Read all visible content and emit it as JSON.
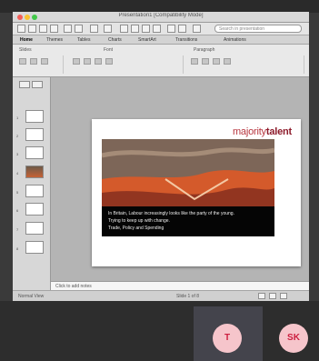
{
  "window": {
    "title": "Presentation1 [Compatibility Mode]"
  },
  "search": {
    "placeholder": "Search in presentation"
  },
  "ribbon": {
    "tabs": [
      "Home",
      "Themes",
      "Tables",
      "Charts",
      "SmartArt",
      "Transitions",
      "Animations"
    ],
    "groups": {
      "slides": "Slides",
      "font": "Font",
      "paragraph": "Paragraph"
    }
  },
  "status": {
    "left": "Normal View",
    "right": "Slide 1 of 8"
  },
  "notes": {
    "placeholder": "Click to add notes"
  },
  "slide": {
    "logo_part1": "majority",
    "logo_part2": "talent",
    "caption_lines": [
      "In Britain, Labour increasingly looks like the party of the young.",
      "Trying to keep up with change.",
      "Trade, Policy and Spending"
    ]
  },
  "participants": {
    "avatar_1": "T",
    "avatar_2": "SK"
  }
}
